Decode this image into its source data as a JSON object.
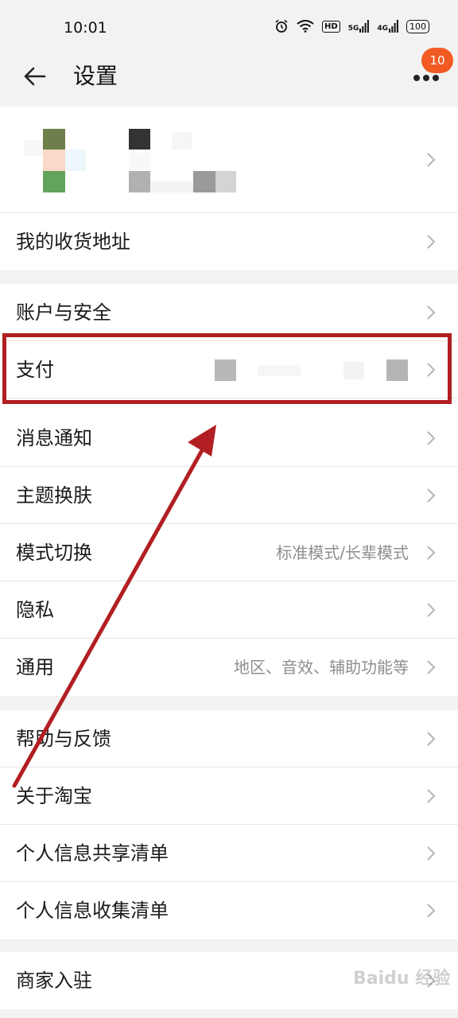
{
  "status_bar": {
    "time": "10:01",
    "badge_hd": "HD",
    "signal_5g": "5G",
    "signal_4g": "4G",
    "battery": "100"
  },
  "nav": {
    "title": "设置",
    "notification_count": "10"
  },
  "sections": {
    "address": {
      "label": "我的收货地址"
    },
    "account": {
      "label": "账户与安全"
    },
    "payment": {
      "label": "支付"
    },
    "notify": {
      "label": "消息通知"
    },
    "theme": {
      "label": "主题换肤"
    },
    "mode": {
      "label": "模式切换",
      "value": "标准模式/长辈模式"
    },
    "privacy": {
      "label": "隐私"
    },
    "general": {
      "label": "通用",
      "value": "地区、音效、辅助功能等"
    },
    "help": {
      "label": "帮助与反馈"
    },
    "about": {
      "label": "关于淘宝"
    },
    "share_list": {
      "label": "个人信息共享清单"
    },
    "collect_list": {
      "label": "个人信息收集清单"
    },
    "merchant": {
      "label": "商家入驻"
    }
  },
  "watermark": "Baidu 经验",
  "colors": {
    "annotation": "#b11f22",
    "badge": "#f15a22",
    "secondary_text": "#8e8e8e"
  },
  "icons": [
    "back-arrow-icon",
    "more-icon",
    "chevron-right-icon",
    "alarm-icon",
    "wifi-icon",
    "battery-icon"
  ]
}
